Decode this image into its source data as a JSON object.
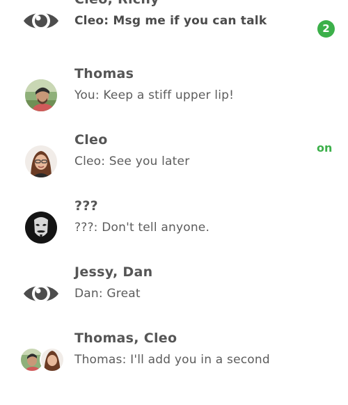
{
  "colors": {
    "accent": "#3cb04a",
    "text": "#555555"
  },
  "conversations": [
    {
      "avatar_icon": "eye-icon",
      "name": "Cleo, Richy",
      "preview": "Cleo: Msg me if you can talk",
      "unread_count": "2"
    },
    {
      "avatar_icon": "avatar-thomas",
      "name": "Thomas",
      "preview": "You: Keep a stiff upper lip!"
    },
    {
      "avatar_icon": "avatar-cleo",
      "name": "Cleo",
      "preview": "Cleo: See you later",
      "status": "on"
    },
    {
      "avatar_icon": "avatar-mask",
      "name": "???",
      "preview": "???: Don't tell anyone."
    },
    {
      "avatar_icon": "eye-icon",
      "name": "Jessy, Dan",
      "preview": "Dan: Great"
    },
    {
      "avatar_icon": "avatar-group",
      "name": "Thomas, Cleo",
      "preview": "Thomas: I'll add you in a second"
    }
  ]
}
